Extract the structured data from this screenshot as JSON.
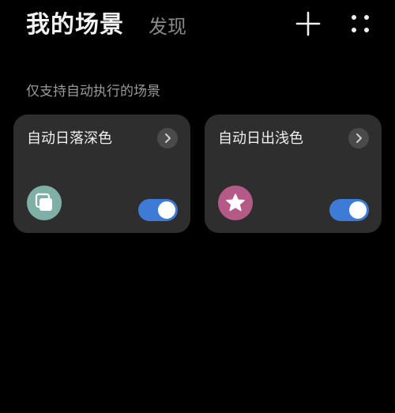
{
  "header": {
    "active_tab": "我的场景",
    "inactive_tab": "发现",
    "add_icon": "plus-icon",
    "more_icon": "four-dots-icon"
  },
  "section": {
    "label": "仅支持自动执行的场景"
  },
  "cards": [
    {
      "title": "自动日落深色",
      "icon": "layers-icon",
      "icon_bg": "#7fb0a5",
      "enabled": true
    },
    {
      "title": "自动日出浅色",
      "icon": "star-icon",
      "icon_bg": "#b55a86",
      "enabled": true
    }
  ],
  "colors": {
    "background": "#000000",
    "card": "#2e2e2e",
    "toggle_on": "#3d7bd6",
    "text_secondary": "#8a8a8a"
  }
}
